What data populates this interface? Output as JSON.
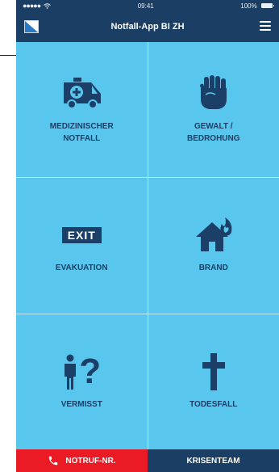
{
  "status": {
    "time": "09:41",
    "battery": "100%"
  },
  "header": {
    "title": "Notfall-App BI ZH"
  },
  "tiles": [
    {
      "label_line1": "MEDIZINISCHER",
      "label_line2": "NOTFALL",
      "icon": "ambulance-icon"
    },
    {
      "label_line1": "GEWALT /",
      "label_line2": "BEDROHUNG",
      "icon": "fist-icon"
    },
    {
      "label_line1": "EVAKUATION",
      "label_line2": "",
      "icon": "exit-sign-icon",
      "icon_text": "EXIT"
    },
    {
      "label_line1": "BRAND",
      "label_line2": "",
      "icon": "house-fire-icon"
    },
    {
      "label_line1": "VERMISST",
      "label_line2": "",
      "icon": "person-question-icon",
      "icon_text": "?"
    },
    {
      "label_line1": "TODESFALL",
      "label_line2": "",
      "icon": "cross-icon"
    }
  ],
  "bottom": {
    "notruf": "NOTRUF-NR.",
    "krisenteam": "KRISENTEAM"
  },
  "colors": {
    "navy": "#1a3e64",
    "tile": "#59c6ee",
    "emergency_red": "#ea1b24"
  }
}
